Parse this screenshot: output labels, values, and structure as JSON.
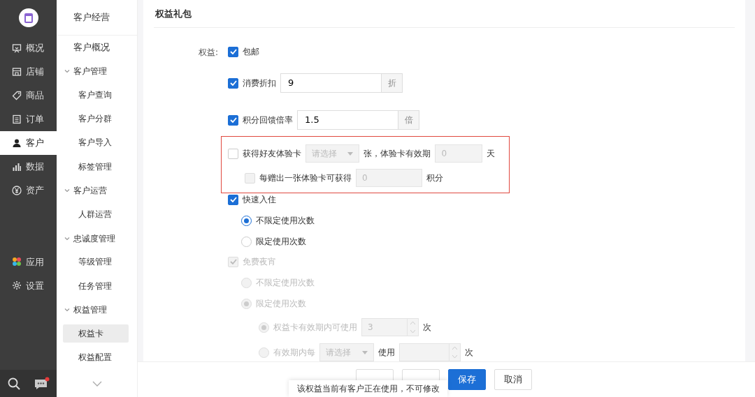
{
  "primary_nav": {
    "items": [
      {
        "label": "概况",
        "selected": false
      },
      {
        "label": "店铺",
        "selected": false
      },
      {
        "label": "商品",
        "selected": false
      },
      {
        "label": "订单",
        "selected": false
      },
      {
        "label": "客户",
        "selected": true
      },
      {
        "label": "数据",
        "selected": false
      },
      {
        "label": "资产",
        "selected": false
      }
    ],
    "bottom_items": [
      {
        "label": "应用",
        "selected": false
      },
      {
        "label": "设置",
        "selected": false
      }
    ],
    "message_unread": true
  },
  "secondary_nav": {
    "title": "客户经营",
    "items": [
      {
        "label": "客户概况",
        "selected": false
      },
      {
        "label": "客户管理",
        "expanded": true,
        "children": [
          {
            "label": "客户查询",
            "selected": false
          },
          {
            "label": "客户分群",
            "selected": false
          },
          {
            "label": "客户导入",
            "selected": false
          },
          {
            "label": "标签管理",
            "selected": false
          }
        ]
      },
      {
        "label": "客户运营",
        "expanded": true,
        "children": [
          {
            "label": "人群运营",
            "selected": false
          }
        ]
      },
      {
        "label": "忠诚度管理",
        "expanded": true,
        "children": [
          {
            "label": "等级管理",
            "selected": false
          },
          {
            "label": "任务管理",
            "selected": false
          }
        ]
      },
      {
        "label": "权益管理",
        "expanded": true,
        "children": [
          {
            "label": "权益卡",
            "selected": true
          },
          {
            "label": "权益配置",
            "selected": false
          }
        ]
      }
    ]
  },
  "section": {
    "title": "权益礼包",
    "field_label": "权益:",
    "benefits": [
      {
        "kind": "plain",
        "label": "包邮",
        "checked": true
      },
      {
        "kind": "input",
        "label": "消费折扣",
        "checked": true,
        "value": "9",
        "unit": "折"
      },
      {
        "kind": "input",
        "label": "积分回馈倍率",
        "checked": true,
        "value": "1.5",
        "unit": "倍"
      },
      {
        "kind": "friend_card",
        "highlighted": true,
        "checked": false,
        "label": "获得好友体验卡",
        "select_placeholder": "请选择",
        "middle": "张，体验卡有效期",
        "days_value": "0",
        "days_unit": "天",
        "sub": {
          "checked": false,
          "label": "每赠出一张体验卡可获得",
          "value": "0",
          "unit": "积分"
        }
      },
      {
        "kind": "options",
        "label": "快速入住",
        "checked": true,
        "options": [
          {
            "label": "不限定使用次数",
            "selected": true
          },
          {
            "label": "限定使用次数",
            "selected": false
          }
        ]
      },
      {
        "kind": "options",
        "label": "免费夜宵",
        "checked": true,
        "disabled": true,
        "options": [
          {
            "label": "不限定使用次数",
            "selected": false
          },
          {
            "label": "限定使用次数",
            "selected": true,
            "sub_options": [
              {
                "kind": "count",
                "label": "权益卡有效期内可使用",
                "selected": true,
                "value": "3",
                "unit": "次"
              },
              {
                "kind": "period",
                "label": "有效期内每",
                "selected": false,
                "select_placeholder": "请选择",
                "middle": "使用",
                "unit": "次"
              }
            ]
          }
        ]
      }
    ]
  },
  "footer": {
    "buttons": [
      {
        "kind": "default"
      },
      {
        "kind": "default"
      },
      {
        "kind": "primary",
        "label": "保存"
      },
      {
        "kind": "default",
        "label": "取消"
      }
    ],
    "toast": "该权益当前有客户正在使用，不可修改"
  }
}
